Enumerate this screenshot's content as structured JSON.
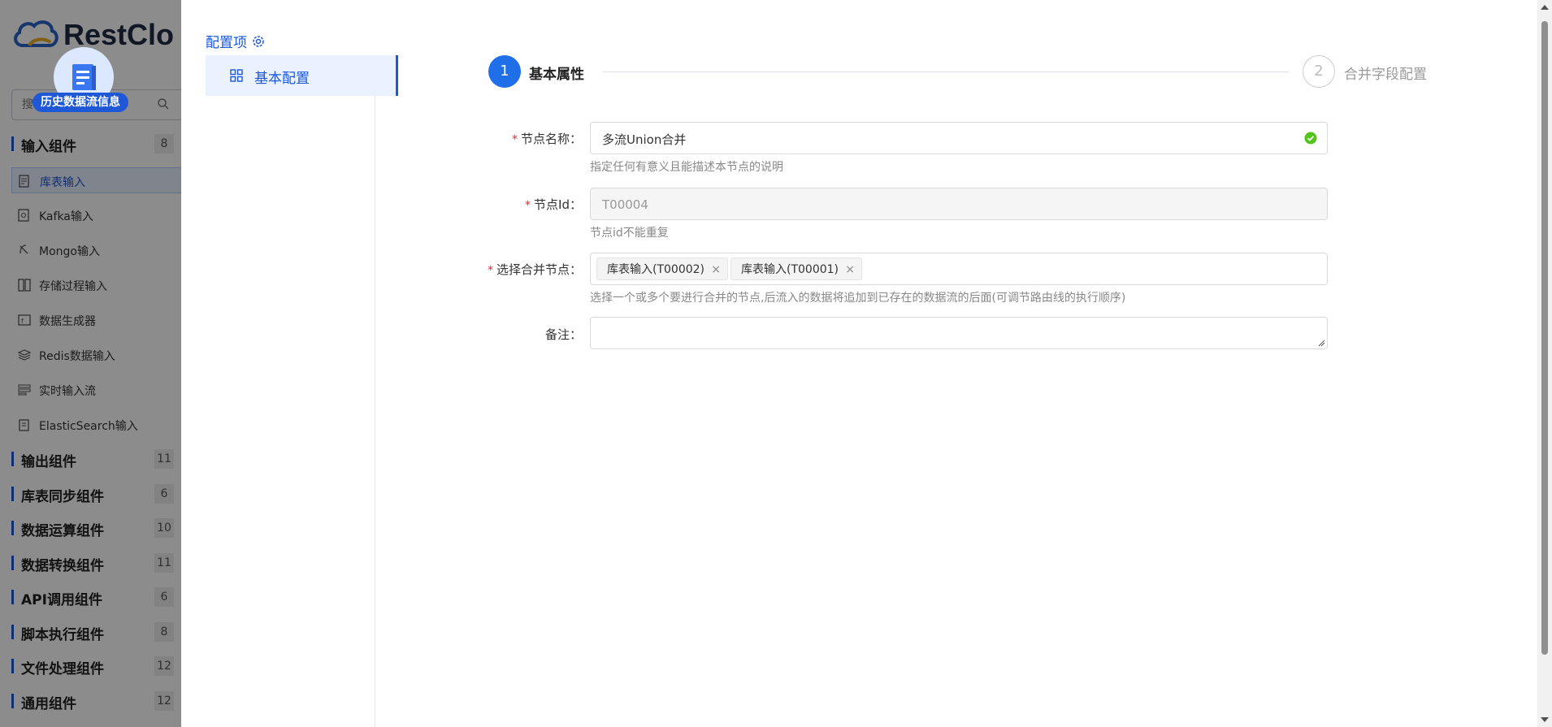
{
  "sidebar": {
    "logo_text": "RestClo",
    "history_label": "历史数据流信息",
    "search_placeholder": "搜",
    "categories": [
      {
        "label": "输入组件",
        "count": "8"
      },
      {
        "label": "输出组件",
        "count": "11"
      },
      {
        "label": "库表同步组件",
        "count": "6"
      },
      {
        "label": "数据运算组件",
        "count": "10"
      },
      {
        "label": "数据转换组件",
        "count": "11"
      },
      {
        "label": "API调用组件",
        "count": "6"
      },
      {
        "label": "脚本执行组件",
        "count": "8"
      },
      {
        "label": "文件处理组件",
        "count": "12"
      },
      {
        "label": "通用组件",
        "count": "12"
      }
    ],
    "input_items": [
      {
        "label": "库表输入"
      },
      {
        "label": "Kafka输入"
      },
      {
        "label": "Mongo输入"
      },
      {
        "label": "存储过程输入"
      },
      {
        "label": "数据生成器"
      },
      {
        "label": "Redis数据输入"
      },
      {
        "label": "实时输入流"
      },
      {
        "label": "ElasticSearch输入"
      }
    ]
  },
  "drawer": {
    "config_title": "配置项",
    "nav_item": "基本配置",
    "steps": [
      {
        "number": "1",
        "label": "基本属性"
      },
      {
        "number": "2",
        "label": "合并字段配置"
      }
    ],
    "form": {
      "node_name_label": "节点名称：",
      "node_name_value": "多流Union合并",
      "node_name_help": "指定任何有意义且能描述本节点的说明",
      "node_id_label": "节点Id：",
      "node_id_value": "T00004",
      "node_id_help": "节点id不能重复",
      "merge_label": "选择合并节点：",
      "merge_tags": [
        {
          "label": "库表输入(T00002)"
        },
        {
          "label": "库表输入(T00001)"
        }
      ],
      "merge_help": "选择一个或多个要进行合并的节点,后流入的数据将追加到已存在的数据流的后面(可调节路由线的执行顺序)",
      "remark_label": "备注：",
      "remark_value": "",
      "required_mark": "*",
      "tag_close": "×"
    }
  },
  "colors": {
    "accent": "#1e58d6",
    "step_active": "#1e6fe8",
    "required": "#f5222d",
    "success": "#52c41a"
  }
}
